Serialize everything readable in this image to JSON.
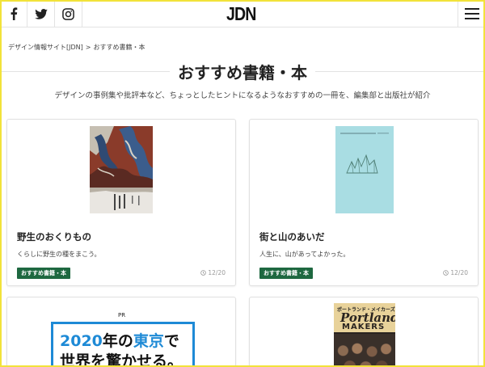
{
  "header": {
    "logo": "JDN",
    "social": [
      "facebook-icon",
      "twitter-icon",
      "instagram-icon"
    ],
    "menu_icon": "hamburger-icon"
  },
  "breadcrumb": {
    "home": "デザイン情報サイト[JDN]",
    "separator": ">",
    "current": "おすすめ書籍・本"
  },
  "page": {
    "title": "おすすめ書籍・本",
    "subtitle": "デザインの事例集や批評本など、ちょっとしたヒントになるようなおすすめの一冊を、編集部と出版社が紹介"
  },
  "cards": [
    {
      "title": "野生のおくりもの",
      "description": "くらしに野生の種をまこう。",
      "tag": "おすすめ書籍・本",
      "date": "12/20"
    },
    {
      "title": "街と山のあいだ",
      "description": "人生に、山があってよかった。",
      "tag": "おすすめ書籍・本",
      "date": "12/20"
    }
  ],
  "ad": {
    "label": "PR",
    "line1_a": "2020",
    "line1_b": "年の",
    "line1_c": "東京",
    "line1_d": "で",
    "line2_a": "世界",
    "line2_b": "を",
    "line2_c": "驚かせる。"
  },
  "book4": {
    "cover_title_top": "ポートランド・メイカーズ",
    "cover_title_main": "Portland",
    "cover_title_sub": "MAKERS"
  },
  "colors": {
    "tag_green": "#1e6840",
    "ad_blue": "#1e8ad6",
    "frame_yellow": "#f2e23a"
  }
}
